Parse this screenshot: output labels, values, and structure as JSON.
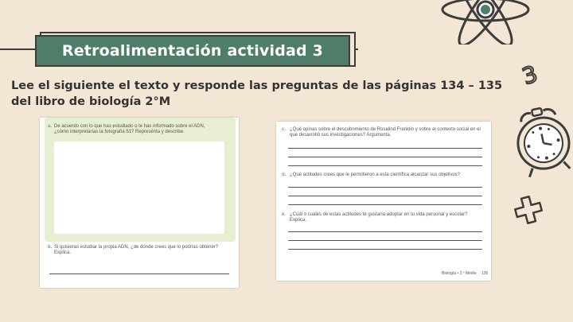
{
  "header": {
    "title": "Retroalimentación actividad 3",
    "instruction": "Lee el siguiente el texto y responde las preguntas de las páginas 134 – 135 del libro de biología 2°M"
  },
  "left_page": {
    "q_a_label": "a.",
    "q_a_text": "De acuerdo con lo que has estudiado o te has informado sobre el ADN, ¿cómo interpretarías la fotografía 51? Represénta y describe.",
    "q_b_label": "b.",
    "q_b_text": "Si quisieras estudiar la propia ADN, ¿de dónde crees que lo podrías obtener? Explica."
  },
  "right_page": {
    "q_c_label": "c.",
    "q_c_text": "¿Qué opinas sobre el descubrimiento de Rosalind Franklin y sobre el contexto social en el que desarrolló sus investigaciones? Argumenta.",
    "q_d_label": "d.",
    "q_d_text": "¿Qué actitudes crees que le permitieron a esta científica alcanzar sus objetivos?",
    "q_e_label": "e.",
    "q_e_text": "¿Cuál o cuáles de estas actitudes te gustaría adoptar en tu vida personal y escolar? Explica.",
    "footer": "Biología • 2.º Medio",
    "page_number": "135"
  },
  "decor": {
    "number_glyph": "3",
    "icons": [
      "atom-icon",
      "alarm-clock-icon",
      "plus-icon"
    ],
    "colors": {
      "accent": "#4e7d69",
      "background": "#f3e6d4",
      "ink": "#3d3d3d"
    }
  }
}
